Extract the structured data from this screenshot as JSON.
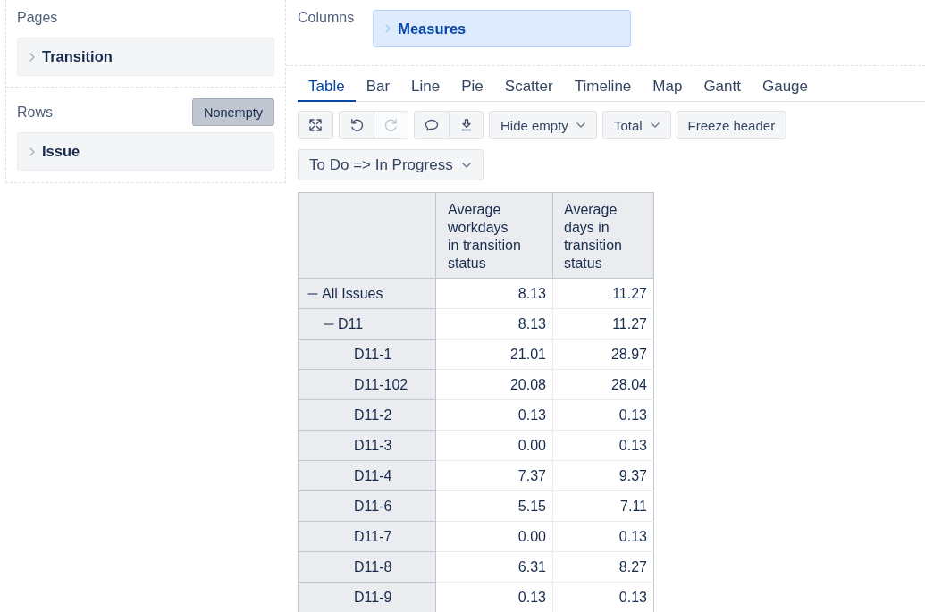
{
  "pages": {
    "label": "Pages",
    "items": [
      {
        "label": "Transition"
      }
    ]
  },
  "rows": {
    "label": "Rows",
    "toggle": {
      "label": "Nonempty",
      "pressed": true
    },
    "items": [
      {
        "label": "Issue"
      }
    ]
  },
  "columns": {
    "label": "Columns",
    "items": [
      {
        "label": "Measures"
      }
    ]
  },
  "tabs": [
    {
      "label": "Table",
      "selected": true
    },
    {
      "label": "Bar",
      "selected": false
    },
    {
      "label": "Line",
      "selected": false
    },
    {
      "label": "Pie",
      "selected": false
    },
    {
      "label": "Scatter",
      "selected": false
    },
    {
      "label": "Timeline",
      "selected": false
    },
    {
      "label": "Map",
      "selected": false
    },
    {
      "label": "Gantt",
      "selected": false
    },
    {
      "label": "Gauge",
      "selected": false
    }
  ],
  "toolbar": {
    "groups": [
      {
        "buttons": [
          {
            "disabled": false
          }
        ]
      },
      {
        "buttons": [
          {
            "disabled": false
          },
          {
            "disabled": true
          }
        ]
      },
      {
        "buttons": [
          {
            "disabled": false
          },
          {
            "disabled": false
          }
        ]
      }
    ],
    "dropdowns": [
      {
        "label": "Hide empty"
      },
      {
        "label": "Total"
      }
    ],
    "buttons": [
      {
        "label": "Freeze header"
      }
    ]
  },
  "filter": {
    "label": "To Do => In Progress"
  },
  "table": {
    "columns": [
      "Average workdays in transition status",
      "Average days in transition status"
    ],
    "rows": [
      {
        "label": "All Issues",
        "expanded": true,
        "values": [
          "8.13",
          "11.27"
        ],
        "children": [
          {
            "label": "D11",
            "expanded": true,
            "values": [
              "8.13",
              "11.27"
            ],
            "children": [
              {
                "label": "D11-1",
                "values": [
                  "21.01",
                  "28.97"
                ]
              },
              {
                "label": "D11-102",
                "values": [
                  "20.08",
                  "28.04"
                ]
              },
              {
                "label": "D11-2",
                "values": [
                  "0.13",
                  "0.13"
                ]
              },
              {
                "label": "D11-3",
                "values": [
                  "0.00",
                  "0.13"
                ]
              },
              {
                "label": "D11-4",
                "values": [
                  "7.37",
                  "9.37"
                ]
              },
              {
                "label": "D11-6",
                "values": [
                  "5.15",
                  "7.11"
                ]
              },
              {
                "label": "D11-7",
                "values": [
                  "0.00",
                  "0.13"
                ]
              },
              {
                "label": "D11-8",
                "values": [
                  "6.31",
                  "8.27"
                ]
              },
              {
                "label": "D11-9",
                "values": [
                  "0.13",
                  "0.13"
                ]
              }
            ]
          }
        ]
      }
    ]
  }
}
